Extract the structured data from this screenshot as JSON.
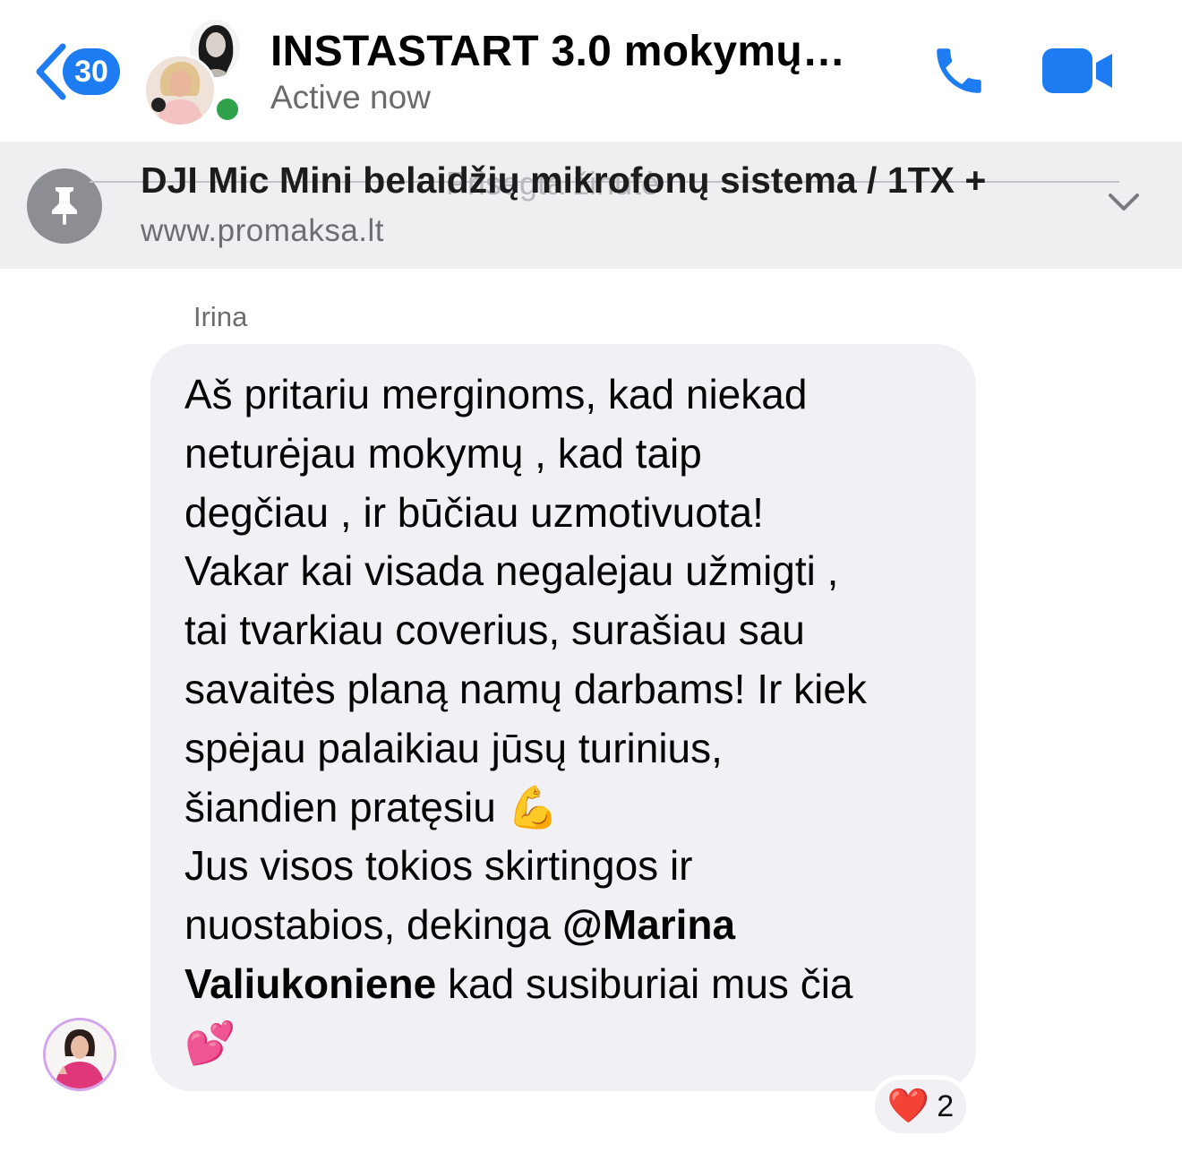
{
  "header": {
    "back_badge": "30",
    "title": "INSTASTART 3.0 mokymų…",
    "status": "Active now",
    "icons": {
      "back": "chevron-left-icon",
      "call": "phone-icon",
      "video": "video-camera-icon"
    }
  },
  "pinned": {
    "title": "DJI Mic Mini belaidžių mikrofonų sistema / 1TX +",
    "url": "www.promaksa.lt",
    "ghost_text": "Prisegta žinutė",
    "icons": {
      "pin": "pin-icon",
      "expand": "chevron-down-icon"
    }
  },
  "message": {
    "sender": "Irina",
    "lines": [
      "Aš pritariu merginoms, kad niekad",
      "neturėjau mokymų , kad taip",
      "degčiau , ir būčiau uzmotivuota!",
      "Vakar kai visada negalejau užmigti ,",
      "tai tvarkiau coverius, surašiau sau",
      "savaitės planą namų darbams! Ir kiek",
      "spėjau palaikiau jūsų turinius,",
      "šiandien pratęsiu 💪",
      "Jus visos tokios skirtingos ir"
    ],
    "line_mention_prefix": "nuostabios, dekinga ",
    "mention_part1": "@Marina",
    "mention_part2": "Valiukoniene",
    "line_after_mention": " kad susiburiai mus čia",
    "last_line": "💕",
    "reaction_emoji": "❤️",
    "reaction_count": "2"
  },
  "colors": {
    "accent": "#1d7cf2",
    "online": "#31a24c",
    "bubble": "#f0f0f5",
    "pinned_bg": "#efeff1"
  }
}
